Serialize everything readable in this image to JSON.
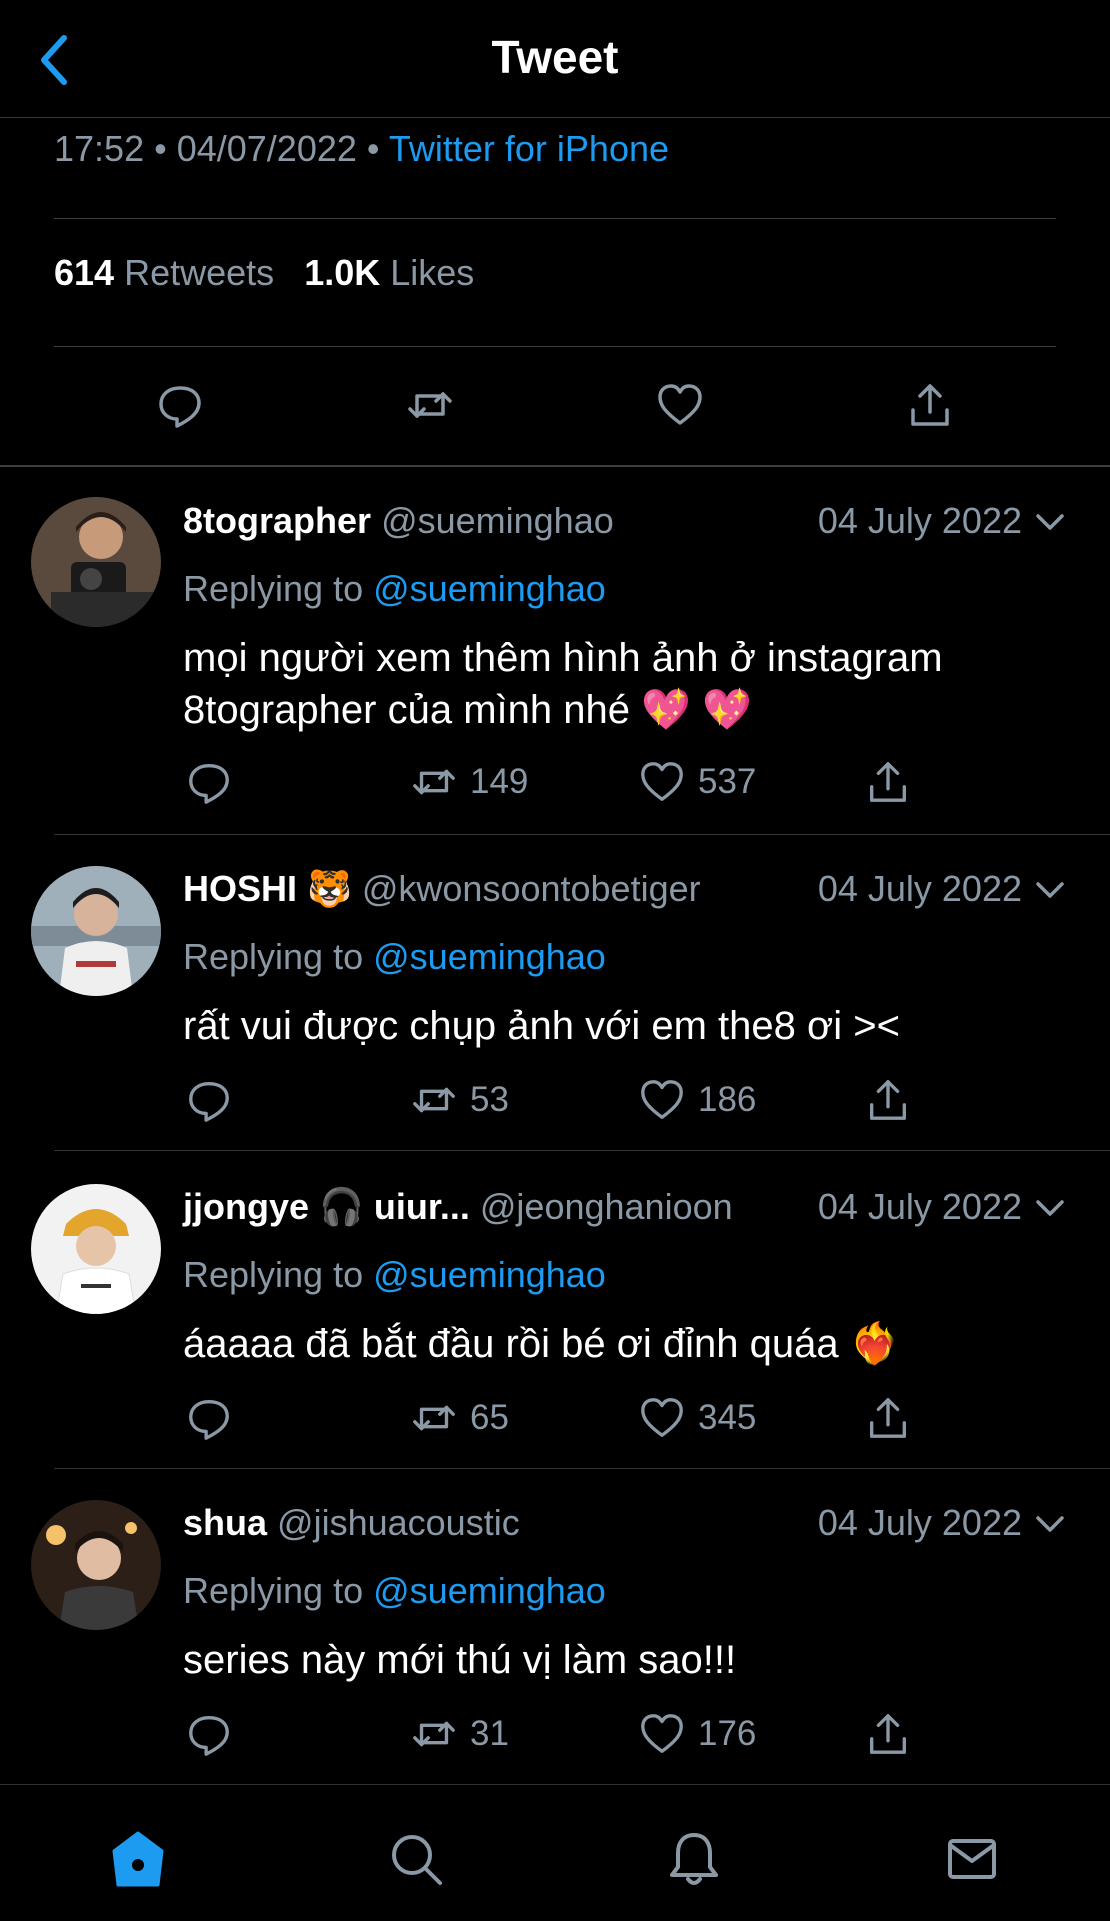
{
  "header": {
    "title": "Tweet"
  },
  "tweet": {
    "time": "17:52",
    "date": "04/07/2022",
    "source": "Twitter for iPhone",
    "retweets_count": "614",
    "retweets_label": "Retweets",
    "likes_count": "1.0K",
    "likes_label": "Likes"
  },
  "replies": [
    {
      "name": "8tographer",
      "handle": "@sueminghao",
      "date": "04 July 2022",
      "replying_prefix": "Replying to",
      "replying_to": "@sueminghao",
      "text": "mọi người xem thêm hình ảnh ở instagram 8tographer của mình nhé 💖 💖",
      "retweets": "149",
      "likes": "537"
    },
    {
      "name": "HOSHI 🐯",
      "handle": "@kwonsoontobetiger",
      "date": "04 July 2022",
      "replying_prefix": "Replying to",
      "replying_to": "@sueminghao",
      "text": "rất vui được chụp ảnh với em the8 ơi ><",
      "retweets": "53",
      "likes": "186"
    },
    {
      "name": "jjongye 🎧 uiur...",
      "handle": "@jeonghanioon",
      "date": "04 July 2022",
      "replying_prefix": "Replying to",
      "replying_to": "@sueminghao",
      "text": "áaaaa đã bắt đầu rồi bé ơi đỉnh quáa ❤️‍🔥",
      "retweets": "65",
      "likes": "345"
    },
    {
      "name": "shua",
      "handle": "@jishuacoustic",
      "date": "04 July 2022",
      "replying_prefix": "Replying to",
      "replying_to": "@sueminghao",
      "text": "series này mới thú vị làm sao!!!",
      "retweets": "31",
      "likes": "176"
    }
  ],
  "colors": {
    "accent": "#1d9bf0",
    "muted": "#8b98a5",
    "background": "#000000"
  },
  "tabbar": {
    "items": [
      "home-icon",
      "search-icon",
      "bell-icon",
      "mail-icon"
    ],
    "active": "home-icon"
  }
}
